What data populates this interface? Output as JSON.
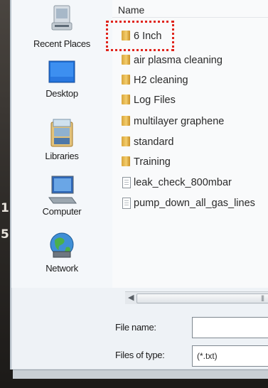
{
  "background": {
    "numerals": [
      "1",
      "5"
    ]
  },
  "places_bar": {
    "items": [
      {
        "label": "Recent Places",
        "icon": "recent-places-icon"
      },
      {
        "label": "Desktop",
        "icon": "desktop-icon"
      },
      {
        "label": "Libraries",
        "icon": "libraries-icon"
      },
      {
        "label": "Computer",
        "icon": "computer-icon"
      },
      {
        "label": "Network",
        "icon": "network-icon"
      }
    ]
  },
  "file_list": {
    "column_header": "Name",
    "items": [
      {
        "name": "6 Inch",
        "type": "folder"
      },
      {
        "name": "air plasma cleaning",
        "type": "folder"
      },
      {
        "name": "H2 cleaning",
        "type": "folder"
      },
      {
        "name": "Log Files",
        "type": "folder"
      },
      {
        "name": "multilayer graphene",
        "type": "folder"
      },
      {
        "name": "standard",
        "type": "folder"
      },
      {
        "name": "Training",
        "type": "folder"
      },
      {
        "name": "leak_check_800mbar",
        "type": "text-file"
      },
      {
        "name": "pump_down_all_gas_lines",
        "type": "text-file"
      }
    ],
    "highlighted_item": "6 Inch",
    "highlight_color": "#e0241c"
  },
  "form": {
    "file_name_label": "File name:",
    "file_name_value": "",
    "file_type_label": "Files of type:",
    "file_type_value": "(*.txt)"
  },
  "colors": {
    "folder": "#e8b84a",
    "dialog_background": "#eef2f6"
  }
}
